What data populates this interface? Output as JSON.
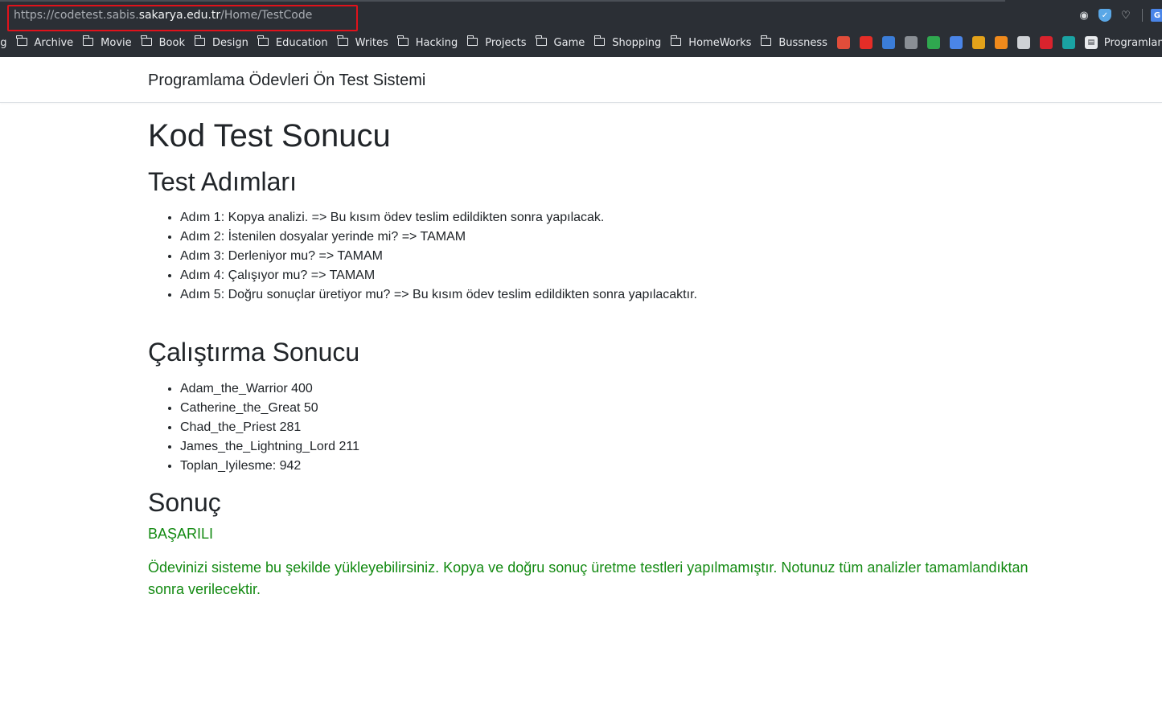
{
  "browser": {
    "url_prefix": "https://codetest.sabis.",
    "url_host": "sakarya.edu.tr",
    "url_path": "/Home/TestCode",
    "bookmarks": [
      {
        "label": "ng",
        "folder": false
      },
      {
        "label": "Archive",
        "folder": true
      },
      {
        "label": "Movie",
        "folder": true
      },
      {
        "label": "Book",
        "folder": true
      },
      {
        "label": "Design",
        "folder": true
      },
      {
        "label": "Education",
        "folder": true
      },
      {
        "label": "Writes",
        "folder": true
      },
      {
        "label": "Hacking",
        "folder": true
      },
      {
        "label": "Projects",
        "folder": true
      },
      {
        "label": "Game",
        "folder": true
      },
      {
        "label": "Shopping",
        "folder": true
      },
      {
        "label": "HomeWorks",
        "folder": true
      },
      {
        "label": "Bussness",
        "folder": true
      }
    ],
    "last_bookmark": "Programlama",
    "favicon_colors": [
      "#e14d3a",
      "#e52d27",
      "#3b7dd8",
      "#8a8f95",
      "#2fa84f",
      "#4a85e8",
      "#e3a21a",
      "#f08a1c",
      "#cfd2d6",
      "#d9232d",
      "#1aa3a3"
    ],
    "favicon_names": [
      "gmail-icon",
      "youtube-icon",
      "wordpress-icon",
      "github-icon",
      "codewars-icon",
      "translate-icon",
      "cn-icon",
      "t-icon",
      "speed-icon",
      "huawei-icon",
      "bing-icon"
    ]
  },
  "site": {
    "brand": "Programlama Ödevleri Ön Test Sistemi"
  },
  "main": {
    "title": "Kod Test Sonucu",
    "steps_heading": "Test Adımları",
    "steps": [
      "Adım 1: Kopya analizi. => Bu kısım ödev teslim edildikten sonra yapılacak.",
      "Adım 2: İstenilen dosyalar yerinde mi? => TAMAM",
      "Adım 3: Derleniyor mu? => TAMAM",
      "Adım 4: Çalışıyor mu? => TAMAM",
      "Adım 5: Doğru sonuçlar üretiyor mu? => Bu kısım ödev teslim edildikten sonra yapılacaktır."
    ],
    "run_heading": "Çalıştırma Sonucu",
    "run_results": [
      "Adam_the_Warrior 400",
      "Catherine_the_Great 50",
      "Chad_the_Priest 281",
      "James_the_Lightning_Lord 211",
      "Toplan_Iyilesme: 942"
    ],
    "result_heading": "Sonuç",
    "result_status": "BAŞARILI",
    "result_message": "Ödevinizi sisteme bu şekilde yükleyebilirsiniz. Kopya ve doğru sonuç üretme testleri yapılmamıştır. Notunuz tüm analizler tamamlandıktan sonra verilecektir."
  }
}
